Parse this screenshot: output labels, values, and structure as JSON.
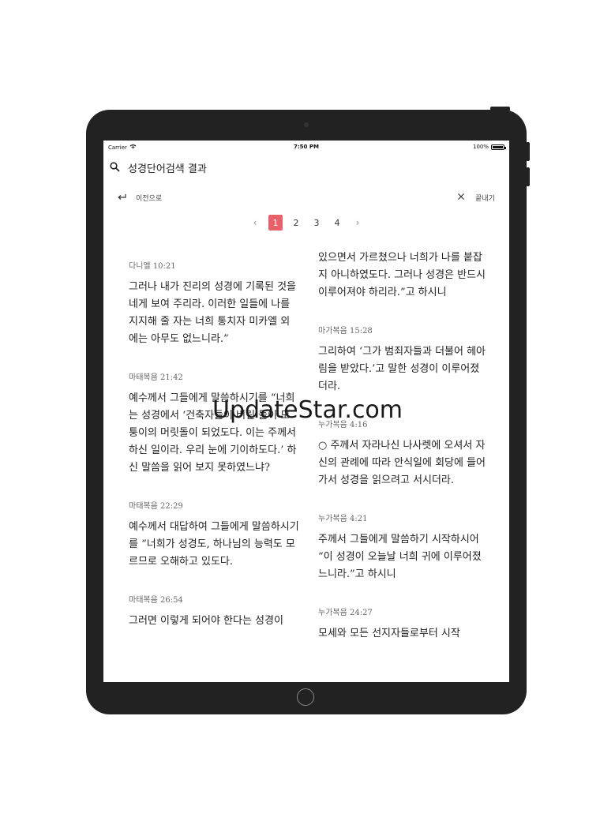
{
  "status": {
    "carrier": "Carrier",
    "time": "7:50 PM",
    "battery": "100%"
  },
  "header": {
    "title": "성경단어검색 결과"
  },
  "nav": {
    "back_label": "이전으로",
    "close_label": "끝내기"
  },
  "pager": {
    "pages": [
      "1",
      "2",
      "3",
      "4"
    ],
    "active": "1"
  },
  "left_column": [
    {
      "ref": "다니엘 10:21",
      "text": "그러나 내가 진리의 성경에 기록된 것을 네게 보여 주리라. 이러한 일들에 나를 지지해 줄 자는 너희 통치자 미카엘 외에는 아무도 없느니라.”"
    },
    {
      "ref": "마태복음 21:42",
      "text": "예수께서 그들에게 말씀하시기를 “너희는 성경에서 ‘건축자들이 버린 돌이 모퉁이의 머릿돌이 되었도다. 이는 주께서 하신 일이라. 우리 눈에 기이하도다.’ 하신 말씀을 읽어 보지 못하였느냐?"
    },
    {
      "ref": "마태복음 22:29",
      "text": "예수께서 대답하여 그들에게 말씀하시기를 “너희가 성경도, 하나님의 능력도 모르므로 오해하고 있도다."
    },
    {
      "ref": "마태복음 26:54",
      "text": "그러면 이렇게 되어야 한다는 성경이"
    }
  ],
  "right_column": [
    {
      "ref": "",
      "text": "있으면서 가르쳤으나 너희가 나를 붙잡지 아니하였도다. 그러나 성경은 반드시 이루어져야 하리라.”고 하시니"
    },
    {
      "ref": "마가복음 15:28",
      "text": "그리하여 ‘그가 범죄자들과 더불어 헤아림을 받았다.’고 말한 성경이 이루어졌더라."
    },
    {
      "ref": "누가복음 4:16",
      "text": "○ 주께서 자라나신 나사렛에 오셔서 자신의 관례에 따라 안식일에 회당에 들어가서 성경을 읽으려고 서시더라."
    },
    {
      "ref": "누가복음 4:21",
      "text": "주께서 그들에게 말씀하기 시작하시어 “이 성경이 오늘날 너희 귀에 이루어졌느니라.”고 하시니"
    },
    {
      "ref": "누가복음 24:27",
      "text": "모세와 모든 선지자들로부터 시작"
    }
  ],
  "watermark": "UpdateStar.com",
  "colors": {
    "accent": "#e8616a",
    "device": "#222222"
  },
  "icons": {
    "search": "search-icon",
    "back": "back-arrow-icon",
    "close": "close-icon",
    "prev": "chevron-left-icon",
    "next": "chevron-right-icon",
    "wifi": "wifi-icon"
  }
}
